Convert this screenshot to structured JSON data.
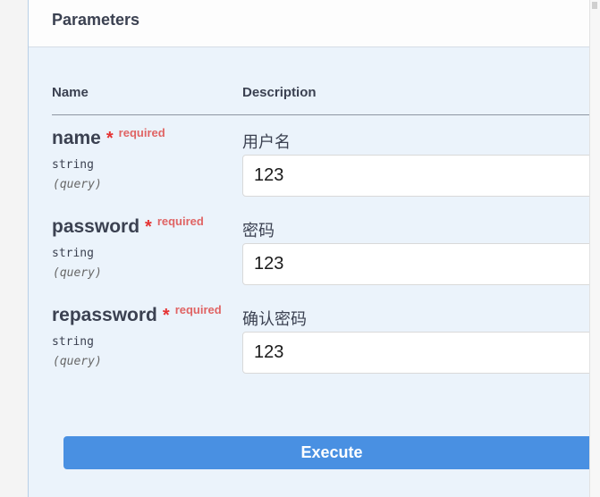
{
  "panel": {
    "title": "Parameters"
  },
  "columns": {
    "name": "Name",
    "description": "Description"
  },
  "params": [
    {
      "name": "name",
      "star": "*",
      "required": "required",
      "type": "string",
      "in": "(query)",
      "description": "用户名",
      "value": "123"
    },
    {
      "name": "password",
      "star": "*",
      "required": "required",
      "type": "string",
      "in": "(query)",
      "description": "密码",
      "value": "123"
    },
    {
      "name": "repassword",
      "star": "*",
      "required": "required",
      "type": "string",
      "in": "(query)",
      "description": "确认密码",
      "value": "123"
    }
  ],
  "execute": {
    "label": "Execute"
  },
  "colors": {
    "accent": "#4990e2",
    "required": "#e53333",
    "panel_bg": "#ebf3fb"
  }
}
